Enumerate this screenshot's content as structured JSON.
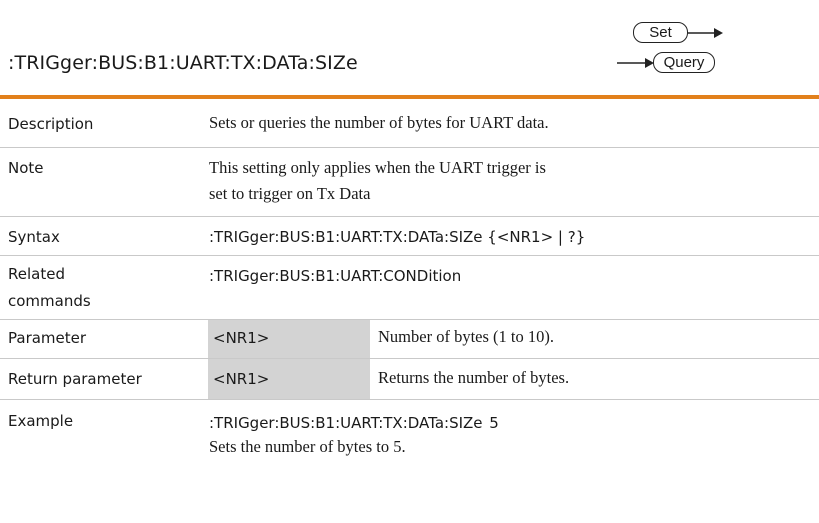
{
  "header": {
    "command": ":TRIGger:BUS:B1:UART:TX:DATa:SIZe",
    "set_label": "Set",
    "query_label": "Query",
    "accent_color": "#e2801b"
  },
  "rows": {
    "description": {
      "label": "Description",
      "text": "Sets or queries the number of bytes for UART data."
    },
    "note": {
      "label": "Note",
      "line1": "This setting only applies when the UART trigger is",
      "line2": "set to trigger on Tx Data"
    },
    "syntax": {
      "label": "Syntax",
      "text": ":TRIGger:BUS:B1:UART:TX:DATa:SIZe {<NR1> | ?}"
    },
    "related": {
      "label1": "Related",
      "label2": "commands",
      "text": ":TRIGger:BUS:B1:UART:CONDition"
    },
    "parameter": {
      "label": "Parameter",
      "type": "<NR1>",
      "desc": "Number of bytes (1 to 10)."
    },
    "return_parameter": {
      "label": "Return parameter",
      "type": "<NR1>",
      "desc": "Returns the number of bytes."
    },
    "example": {
      "label": "Example",
      "code": ":TRIGger:BUS:B1:UART:TX:DATa:SIZe 5",
      "text": "Sets the number of bytes to 5."
    }
  }
}
